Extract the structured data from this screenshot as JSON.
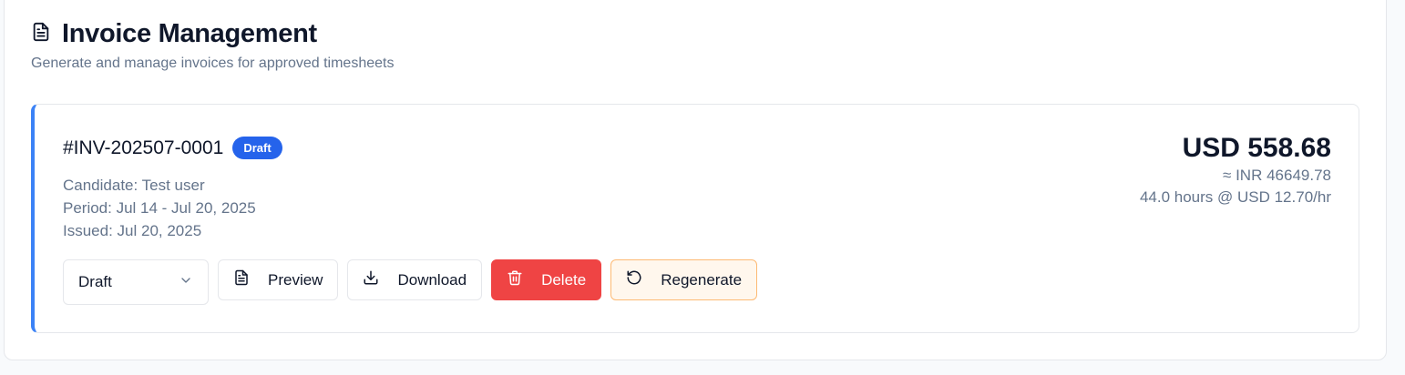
{
  "header": {
    "title": "Invoice Management",
    "subtitle": "Generate and manage invoices for approved timesheets",
    "icon": "document-icon"
  },
  "invoice": {
    "number": "#INV-202507-0001",
    "status_badge": "Draft",
    "candidate": "Candidate: Test user",
    "period": "Period: Jul 14 - Jul 20, 2025",
    "issued": "Issued: Jul 20, 2025",
    "amount_usd": "USD 558.68",
    "amount_inr": "≈ INR 46649.78",
    "hours_rate": "44.0 hours @ USD 12.70/hr",
    "accent_color": "#3b82f6",
    "badge_color": "#2563eb"
  },
  "actions": {
    "status_select_value": "Draft",
    "preview_label": "Preview",
    "download_label": "Download",
    "delete_label": "Delete",
    "regenerate_label": "Regenerate",
    "delete_color": "#ef4444",
    "regenerate_bg": "#fff7ed"
  }
}
